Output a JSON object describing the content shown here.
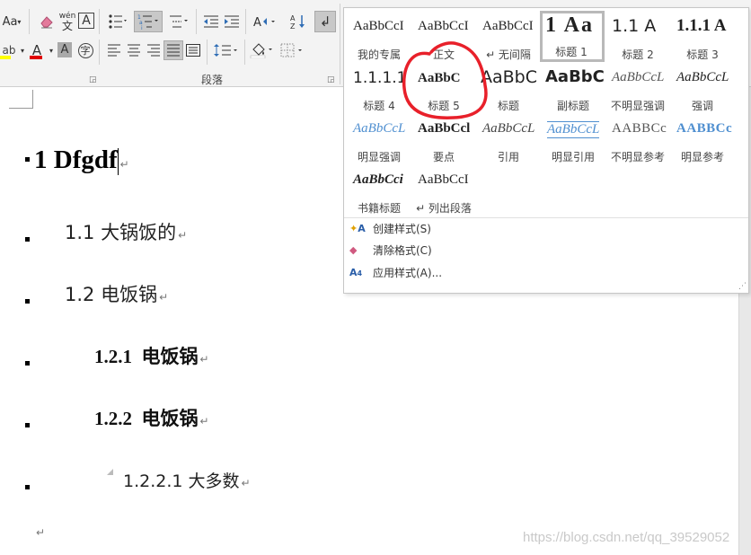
{
  "ribbon": {
    "font_size_label": "Aa",
    "phonetic_top": "wén",
    "phonetic_bottom": "文",
    "char_border": "A",
    "text_color_label": "A",
    "char_shade_label": "A",
    "enclose_char": "字",
    "paragraph_group_label": "段落",
    "sort_label": "A↓Z"
  },
  "gallery": {
    "styles": [
      {
        "sample": "AaBbCcI",
        "label": "我的专属"
      },
      {
        "sample": "AaBbCcI",
        "label": "正文"
      },
      {
        "sample": "AaBbCcI",
        "label": "↵ 无间隔"
      },
      {
        "sample": "1 Aa",
        "label": "标题 1"
      },
      {
        "sample": "1.1 A",
        "label": "标题 2"
      },
      {
        "sample": "1.1.1 A",
        "label": "标题 3"
      },
      {
        "sample": "1.1.1.1",
        "label": "标题 4"
      },
      {
        "sample": "AaBbC",
        "label": "标题 5"
      },
      {
        "sample": "AaBbC",
        "label": "标题"
      },
      {
        "sample": "AaBbC",
        "label": "副标题"
      },
      {
        "sample": "AaBbCcL",
        "label": "不明显强调"
      },
      {
        "sample": "AaBbCcL",
        "label": "强调"
      },
      {
        "sample": "AaBbCcL",
        "label": "明显强调"
      },
      {
        "sample": "AaBbCcl",
        "label": "要点"
      },
      {
        "sample": "AaBbCcL",
        "label": "引用"
      },
      {
        "sample": "AaBbCcL",
        "label": "明显引用"
      },
      {
        "sample": "AABBCc",
        "label": "不明显参考"
      },
      {
        "sample": "AABBCc",
        "label": "明显参考"
      },
      {
        "sample": "AaBbCci",
        "label": "书籍标题"
      },
      {
        "sample": "AaBbCcI",
        "label": "↵ 列出段落"
      }
    ],
    "menu": {
      "create_style": "创建样式(S)",
      "clear_format": "清除格式(C)",
      "apply_styles": "应用样式(A)..."
    },
    "accent_blue": "#2f6db5",
    "annotation_color": "#e8202a"
  },
  "document": {
    "heading1": "1 Dfgdf",
    "heading2a": "1.1 大锅饭的",
    "heading2b": "1.2 电饭锅",
    "heading3a": "1.2.1  电饭锅",
    "heading3b": "1.2.2  电饭锅",
    "heading4": "1.2.2.1 大多数",
    "paragraph_mark": "↵"
  },
  "watermark": "https://blog.csdn.net/qq_39529052"
}
